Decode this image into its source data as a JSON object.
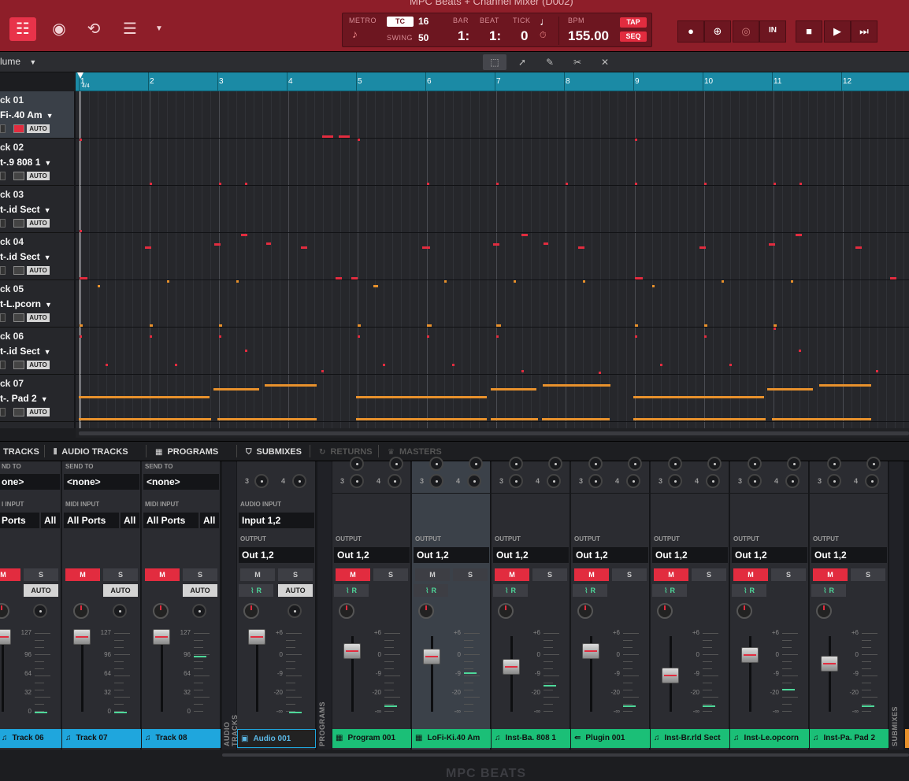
{
  "window": {
    "title": "MPC Beats + Channel Mixer (D002)"
  },
  "transport": {
    "metro_label": "METRO",
    "tc_label": "TC",
    "tc_value": "16",
    "swing_label": "SWING",
    "swing_value": "50",
    "bar_label": "BAR",
    "beat_label": "BEAT",
    "tick_label": "TICK",
    "bar_value": "1:",
    "beat_value": "1:",
    "tick_value": "0",
    "bpm_label": "BPM",
    "bpm_value": "155.00",
    "tap_label": "TAP",
    "seq_label": "SEQ",
    "in_label": "IN"
  },
  "toolbar": {
    "volume_label": "lume"
  },
  "ruler": {
    "bars": [
      "1",
      "2",
      "3",
      "4",
      "5",
      "6",
      "7",
      "8",
      "9",
      "10",
      "11",
      "12"
    ],
    "time_sig": "4/4"
  },
  "tracks": [
    {
      "name": "ck 01",
      "program": "Fi-.40 Am",
      "auto": "AUTO",
      "selected": true
    },
    {
      "name": "ck 02",
      "program": "t-.9 808 1",
      "auto": "AUTO",
      "selected": false
    },
    {
      "name": "ck 03",
      "program": "t-.id Sect",
      "auto": "AUTO",
      "selected": false
    },
    {
      "name": "ck 04",
      "program": "t-.id Sect",
      "auto": "AUTO",
      "selected": false
    },
    {
      "name": "ck 05",
      "program": "t-L.pcorn",
      "auto": "AUTO",
      "selected": false
    },
    {
      "name": "ck 06",
      "program": "t-.id Sect",
      "auto": "AUTO",
      "selected": false
    },
    {
      "name": "ck 07",
      "program": "t-. Pad 2",
      "auto": "AUTO",
      "selected": false
    }
  ],
  "mixer_tabs": [
    {
      "label": "TRACKS",
      "icon": "midi-icon",
      "dim": false
    },
    {
      "label": "AUDIO TRACKS",
      "icon": "waveform-icon",
      "dim": false
    },
    {
      "label": "PROGRAMS",
      "icon": "grid-icon",
      "dim": false
    },
    {
      "label": "SUBMIXES",
      "icon": "submix-icon",
      "dim": false
    },
    {
      "label": "RETURNS",
      "icon": "return-icon",
      "dim": true
    },
    {
      "label": "MASTERS",
      "icon": "crown-icon",
      "dim": true
    }
  ],
  "midi_strips": [
    {
      "send_label": "ND TO",
      "send": "one>",
      "input_label": "I INPUT",
      "input": "Ports",
      "all": "All",
      "mute": "M",
      "solo": "S",
      "auto": "AUTO",
      "scale": [
        "127",
        "96",
        "64",
        "32",
        "0"
      ],
      "name": "Track 06"
    },
    {
      "send_label": "SEND TO",
      "send": "<none>",
      "input_label": "MIDI INPUT",
      "input": "All Ports",
      "all": "All",
      "mute": "M",
      "solo": "S",
      "auto": "AUTO",
      "scale": [
        "127",
        "96",
        "64",
        "32",
        "0"
      ],
      "name": "Track 07"
    },
    {
      "send_label": "SEND TO",
      "send": "<none>",
      "input_label": "MIDI INPUT",
      "input": "All Ports",
      "all": "All",
      "mute": "M",
      "solo": "S",
      "auto": "AUTO",
      "scale": [
        "127",
        "96",
        "64",
        "32",
        "0"
      ],
      "name": "Track 08"
    }
  ],
  "audio_group_label": "AUDIO TRACKS",
  "audio_strip": {
    "send_label": "3",
    "send2_label": "4",
    "input_label": "AUDIO INPUT",
    "input": "Input 1,2",
    "output_label": "OUTPUT",
    "output": "Out 1,2",
    "mute": "M",
    "solo": "S",
    "read": "R",
    "auto": "AUTO",
    "scale": [
      "+6",
      "0",
      "-9",
      "-20",
      "-∞"
    ],
    "name": "Audio 001"
  },
  "programs_group_label": "PROGRAMS",
  "program_strips": [
    {
      "output_label": "OUTPUT",
      "output": "Out 1,2",
      "mute": "M",
      "solo": "S",
      "read": "R",
      "scale": [
        "+6",
        "0",
        "-9",
        "-20",
        "-∞"
      ],
      "name": "Program 001",
      "fader": 0.74,
      "meter": 0.08
    },
    {
      "output_label": "OUTPUT",
      "output": "Out 1,2",
      "mute": "M",
      "solo": "S",
      "read": "R",
      "scale": [
        "+6",
        "0",
        "-9",
        "-20",
        "-∞"
      ],
      "name": "LoFi-Ki.40 Am",
      "fader": 0.66,
      "meter": 0.52
    },
    {
      "output_label": "OUTPUT",
      "output": "Out 1,2",
      "mute": "M",
      "solo": "S",
      "read": "R",
      "scale": [
        "+6",
        "0",
        "-9",
        "-20",
        "-∞"
      ],
      "name": "Inst-Ba. 808 1",
      "fader": 0.52,
      "meter": 0.35
    },
    {
      "output_label": "OUTPUT",
      "output": "Out 1,2",
      "mute": "M",
      "solo": "S",
      "read": "R",
      "scale": [
        "+6",
        "0",
        "-9",
        "-20",
        "-∞"
      ],
      "name": "Plugin 001",
      "fader": 0.74,
      "meter": 0.08
    },
    {
      "output_label": "OUTPUT",
      "output": "Out 1,2",
      "mute": "M",
      "solo": "S",
      "read": "R",
      "scale": [
        "+6",
        "0",
        "-9",
        "-20",
        "-∞"
      ],
      "name": "Inst-Br.rld Sect",
      "fader": 0.4,
      "meter": 0.08
    },
    {
      "output_label": "OUTPUT",
      "output": "Out 1,2",
      "mute": "M",
      "solo": "S",
      "read": "R",
      "scale": [
        "+6",
        "0",
        "-9",
        "-20",
        "-∞"
      ],
      "name": "Inst-Le.opcorn",
      "fader": 0.69,
      "meter": 0.3
    },
    {
      "output_label": "OUTPUT",
      "output": "Out 1,2",
      "mute": "M",
      "solo": "S",
      "read": "R",
      "scale": [
        "+6",
        "0",
        "-9",
        "-20",
        "-∞"
      ],
      "name": "Inst-Pa. Pad 2",
      "fader": 0.56,
      "meter": 0.08
    }
  ],
  "submixes_group_label": "SUBMIXES",
  "footer": {
    "logo": "MPC BEATS"
  }
}
